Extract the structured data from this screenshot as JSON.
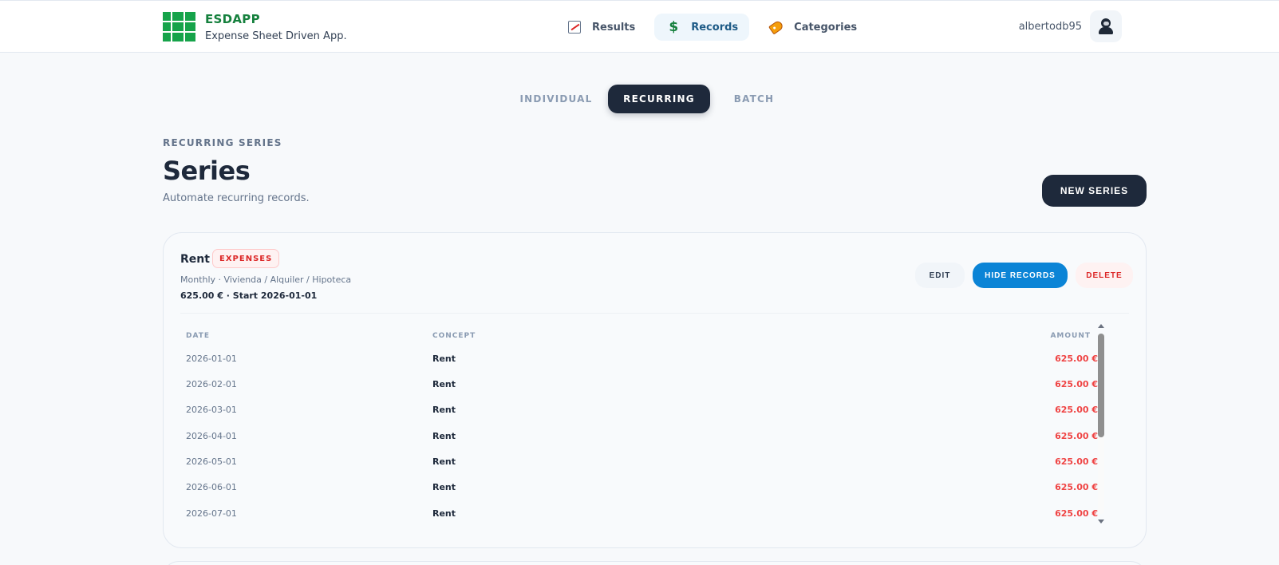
{
  "brand": {
    "name": "ESDAPP",
    "subtitle": "Expense Sheet Driven App.",
    "color": "#16a34a"
  },
  "nav": {
    "items": [
      {
        "label": "Results",
        "icon": "chart-icon",
        "active": false
      },
      {
        "label": "Records",
        "icon": "dollar-icon",
        "active": true
      },
      {
        "label": "Categories",
        "icon": "tag-icon",
        "active": false
      }
    ]
  },
  "user": {
    "name": "albertodb95",
    "avatar": "user-avatar-icon"
  },
  "tabs": [
    {
      "label": "INDIVIDUAL",
      "active": false
    },
    {
      "label": "RECURRING",
      "active": true
    },
    {
      "label": "BATCH",
      "active": false
    }
  ],
  "header": {
    "eyebrow": "RECURRING SERIES",
    "title": "Series",
    "subtitle": "Automate recurring records.",
    "new_button": "NEW SERIES"
  },
  "series": {
    "name": "Rent",
    "badge": "EXPENSES",
    "meta": "Monthly · Vivienda / Alquiler / Hipoteca",
    "amount_line": "625.00 € · Start 2026-01-01",
    "actions": {
      "edit": "EDIT",
      "hide": "HIDE RECORDS",
      "delete": "DELETE"
    },
    "table": {
      "columns": [
        "DATE",
        "CONCEPT",
        "AMOUNT"
      ],
      "rows": [
        {
          "date": "2026-01-01",
          "concept": "Rent",
          "amount": "625.00 €"
        },
        {
          "date": "2026-02-01",
          "concept": "Rent",
          "amount": "625.00 €"
        },
        {
          "date": "2026-03-01",
          "concept": "Rent",
          "amount": "625.00 €"
        },
        {
          "date": "2026-04-01",
          "concept": "Rent",
          "amount": "625.00 €"
        },
        {
          "date": "2026-05-01",
          "concept": "Rent",
          "amount": "625.00 €"
        },
        {
          "date": "2026-06-01",
          "concept": "Rent",
          "amount": "625.00 €"
        },
        {
          "date": "2026-07-01",
          "concept": "Rent",
          "amount": "625.00 €"
        }
      ]
    }
  },
  "colors": {
    "accent_dark": "#1e293b",
    "primary_blue": "#0b84d6",
    "expense_red": "#ef4444"
  }
}
